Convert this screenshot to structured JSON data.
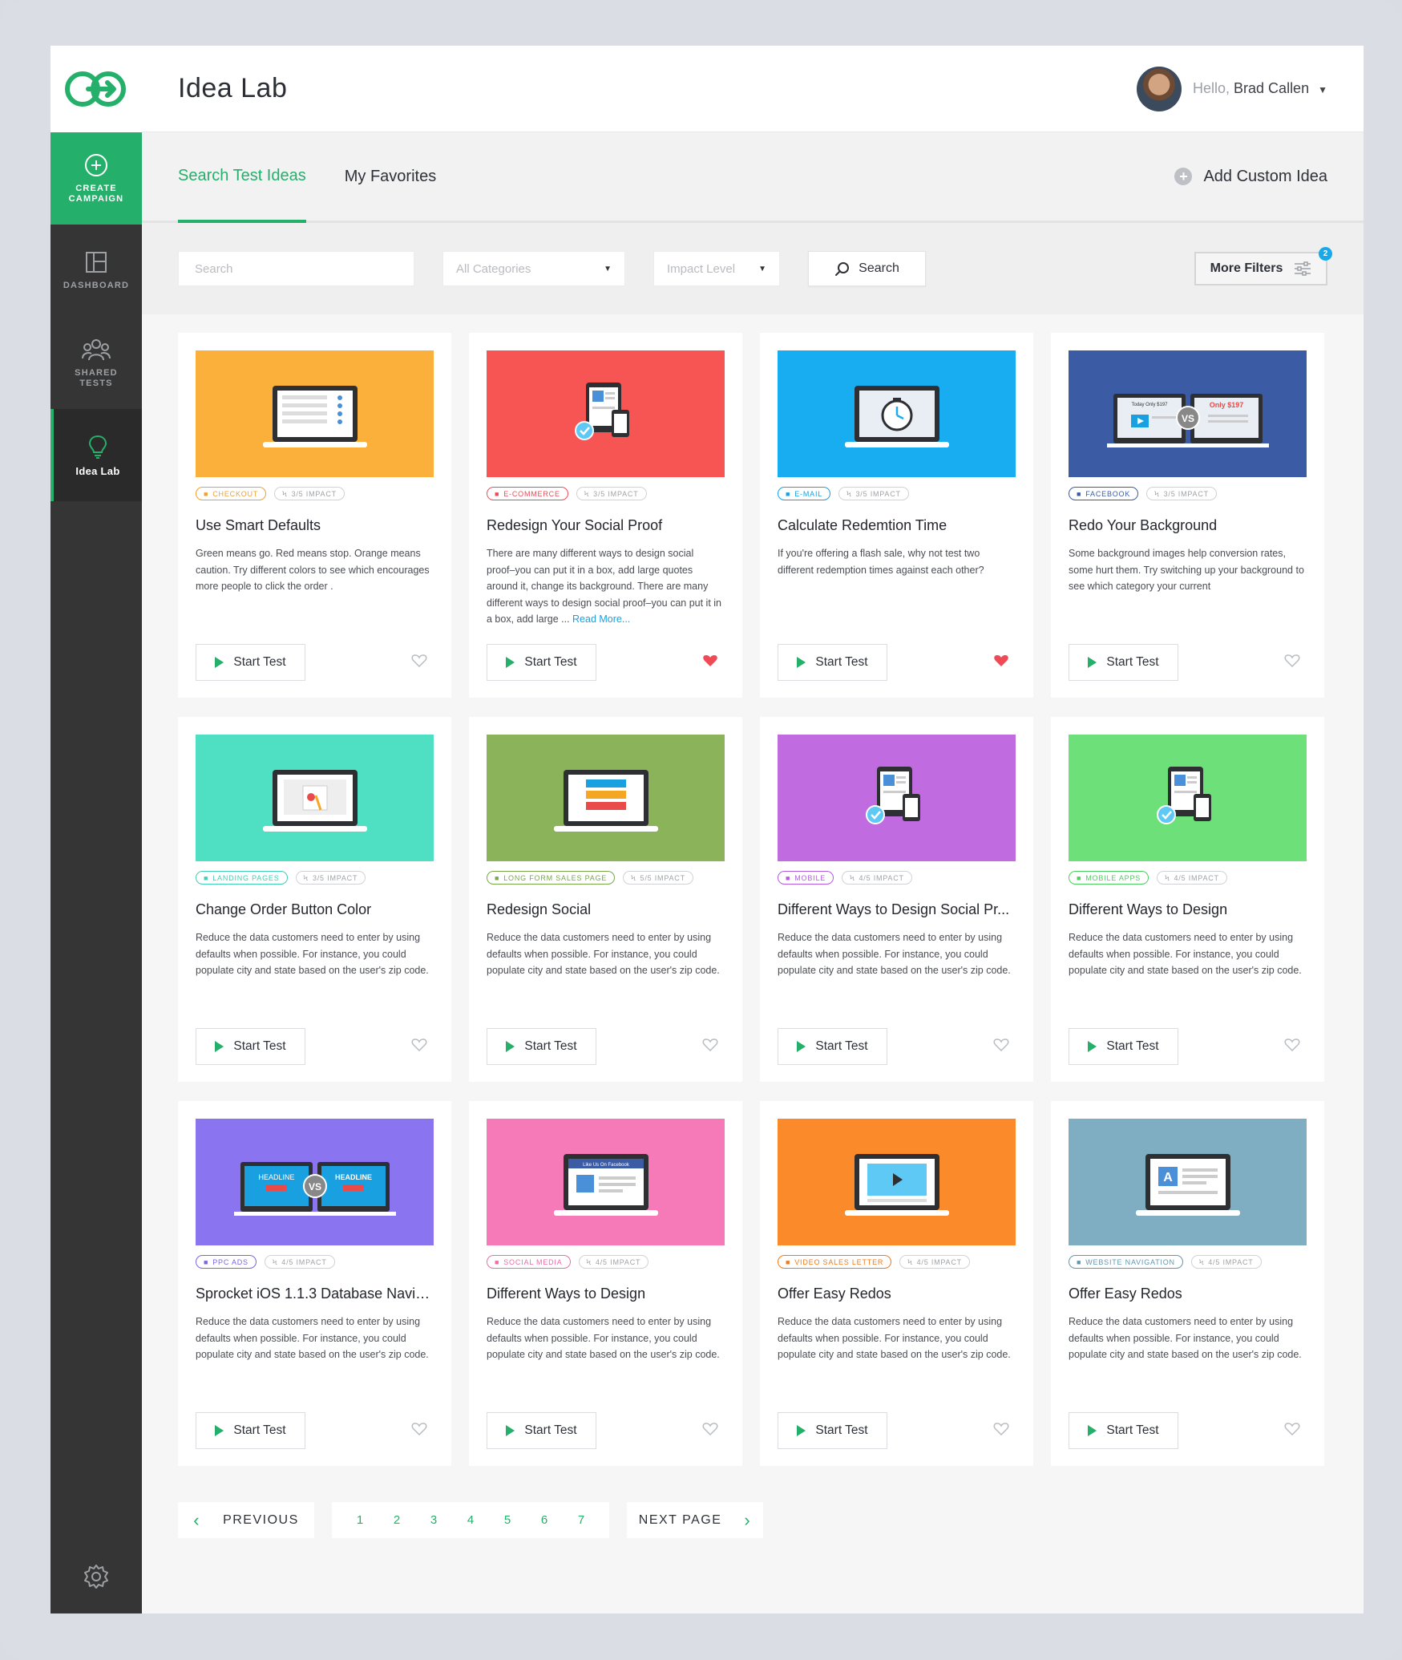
{
  "colors": {
    "accent": "#24b06a",
    "link": "#18a0e0",
    "favorite": "#ef4b57"
  },
  "sidebar": {
    "create_label": "CREATE CAMPAIGN",
    "items": [
      {
        "label": "DASHBOARD",
        "icon": "dashboard-icon"
      },
      {
        "label": "SHARED TESTS",
        "icon": "people-icon"
      },
      {
        "label": "Idea Lab",
        "icon": "lightbulb-icon"
      }
    ]
  },
  "header": {
    "title": "Idea Lab",
    "greeting": "Hello,",
    "user_name": "Brad Callen"
  },
  "tabs": {
    "search_ideas": "Search Test Ideas",
    "favorites": "My Favorites",
    "add_custom": "Add Custom Idea"
  },
  "filters": {
    "search_placeholder": "Search",
    "categories": "All Categories",
    "impact": "Impact Level",
    "search_button": "Search",
    "more_filters": "More Filters",
    "more_filters_count": "2"
  },
  "cards": [
    {
      "title": "Use Smart Defaults",
      "category": "CHECKOUT",
      "impact": "3/5 IMPACT",
      "desc": "Green means go. Red means stop. Orange means caution. Try different colors to see which encourages more people to click the order .",
      "read_more": "",
      "color": "#fbb03b",
      "tag_color": "#f0a030",
      "favorite": false,
      "thumb": "laptop-form"
    },
    {
      "title": "Redesign Your Social Proof",
      "category": "E-COMMERCE",
      "impact": "3/5 IMPACT",
      "desc": "There are many different ways to design social proof–you can put it in a box, add large quotes around it, change its background. There are many different ways to design social proof–you can put it in a box, add large ...",
      "read_more": "Read More...",
      "color": "#f75454",
      "tag_color": "#ef4b57",
      "favorite": true,
      "thumb": "devices"
    },
    {
      "title": "Calculate Redemtion Time",
      "category": "E-MAIL",
      "impact": "3/5 IMPACT",
      "desc": "If you're offering a flash sale, why not test two different redemption times against each other?",
      "read_more": "",
      "color": "#18adf0",
      "tag_color": "#18a0e0",
      "favorite": true,
      "thumb": "laptop-clock"
    },
    {
      "title": "Redo Your Background",
      "category": "FACEBOOK",
      "impact": "3/5 IMPACT",
      "desc": "Some background images help conversion rates, some hurt them. Try switching up your background to see which category your current",
      "read_more": "",
      "color": "#3b5ba5",
      "tag_color": "#3b5ba5",
      "favorite": false,
      "thumb": "vs-price",
      "vs_left": "Today Only $197",
      "vs_right": "Only $197"
    },
    {
      "title": "Change Order Button Color",
      "category": "LANDING PAGES",
      "impact": "3/5 IMPACT",
      "desc": "Reduce the data customers need to enter by using defaults when possible. For instance, you could populate city and state based on the user's zip code.",
      "read_more": "",
      "color": "#4fe0c4",
      "tag_color": "#3fcfb3",
      "favorite": false,
      "thumb": "laptop-click"
    },
    {
      "title": "Redesign Social",
      "category": "LONG FORM SALES PAGE",
      "impact": "5/5 IMPACT",
      "desc": "Reduce the data customers need to enter by using defaults when possible. For instance, you could populate city and state based on the user's zip code.",
      "read_more": "",
      "color": "#8ab35a",
      "tag_color": "#7aa64a",
      "favorite": false,
      "thumb": "laptop-list"
    },
    {
      "title": "Different Ways to Design Social Pr...",
      "category": "MOBILE",
      "impact": "4/5 IMPACT",
      "desc": "Reduce the data customers need to enter by using defaults when possible. For instance, you could populate city and state based on the user's zip code.",
      "read_more": "",
      "color": "#c06be0",
      "tag_color": "#b45be0",
      "favorite": false,
      "thumb": "devices"
    },
    {
      "title": "Different Ways to Design",
      "category": "MOBILE APPS",
      "impact": "4/5 IMPACT",
      "desc": "Reduce the data customers need to enter by using defaults when possible. For instance, you could populate city and state based on the user's zip code.",
      "read_more": "",
      "color": "#6ee07a",
      "tag_color": "#4ccf5e",
      "favorite": false,
      "thumb": "devices"
    },
    {
      "title": "Sprocket iOS 1.1.3 Database Navig...",
      "category": "PPC ADS",
      "impact": "4/5 IMPACT",
      "desc": "Reduce the data customers need to enter by using defaults when possible. For instance, you could populate city and state based on the user's zip code.",
      "read_more": "",
      "color": "#8a74f0",
      "tag_color": "#7a64e0",
      "favorite": false,
      "thumb": "vs-headline",
      "vs_left": "HEADLINE",
      "vs_right": "HEADLINE"
    },
    {
      "title": "Different Ways to Design",
      "category": "SOCIAL MEDIA",
      "impact": "4/5 IMPACT",
      "desc": "Reduce the data customers need to enter by using defaults when possible. For instance, you could populate city and state based on the user's zip code.",
      "read_more": "",
      "color": "#f77ab8",
      "tag_color": "#ee6aa8",
      "favorite": false,
      "thumb": "laptop-like",
      "screen_text": "Like Us On Facebook"
    },
    {
      "title": "Offer Easy Redos",
      "category": "VIDEO SALES LETTER",
      "impact": "4/5 IMPACT",
      "desc": "Reduce the data customers need to enter by using defaults when possible. For instance, you could populate city and state based on the user's zip code.",
      "read_more": "",
      "color": "#fb8a2a",
      "tag_color": "#f07a1a",
      "favorite": false,
      "thumb": "laptop-video"
    },
    {
      "title": "Offer Easy Redos",
      "category": "WEBSITE NAVIGATION",
      "impact": "4/5 IMPACT",
      "desc": "Reduce the data customers need to enter by using defaults when possible. For instance, you could populate city and state based on the user's zip code.",
      "read_more": "",
      "color": "#7fadc2",
      "tag_color": "#5f97b0",
      "favorite": false,
      "thumb": "laptop-a"
    }
  ],
  "card_button": "Start Test",
  "pagination": {
    "previous": "PREVIOUS",
    "next": "NEXT PAGE",
    "pages": [
      "1",
      "2",
      "3",
      "4",
      "5",
      "6",
      "7"
    ]
  }
}
